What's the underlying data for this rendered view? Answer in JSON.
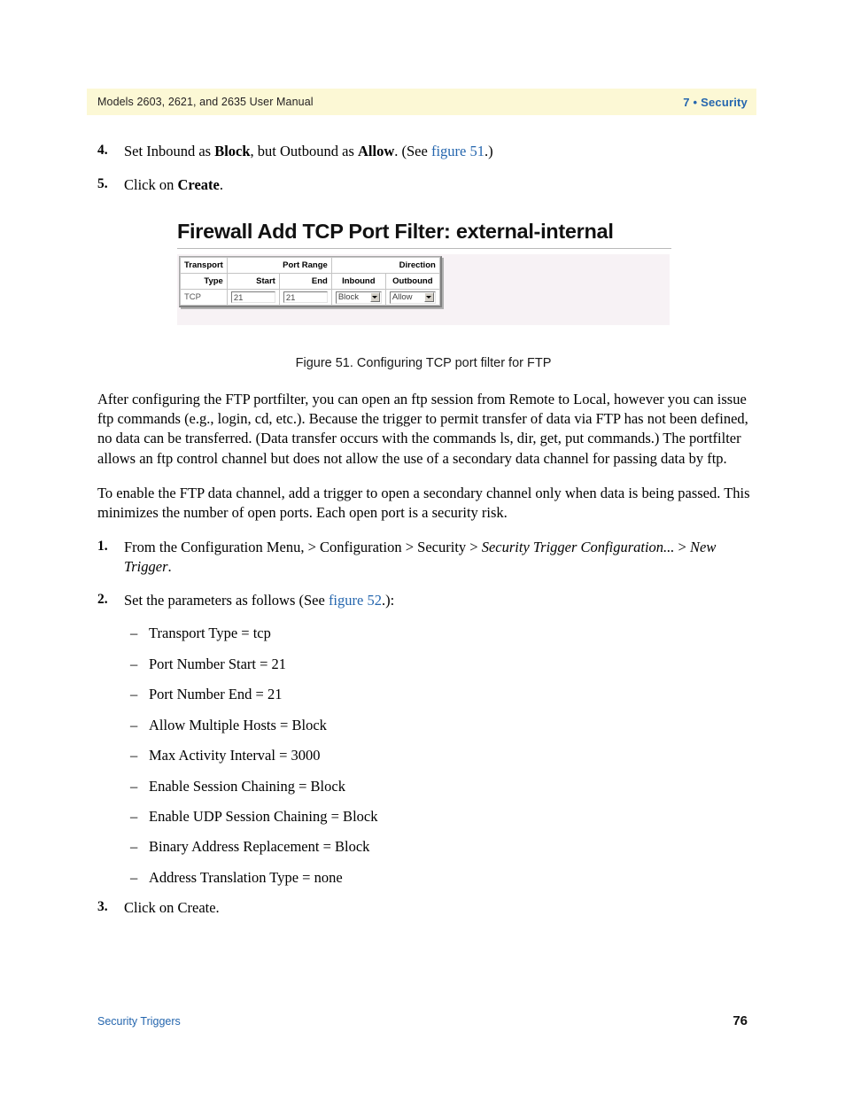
{
  "header": {
    "left": "Models 2603, 2621, and 2635 User Manual",
    "right": "7 • Security",
    "band_color": "#fcf8d5",
    "accent_color": "#2566ae"
  },
  "top_steps": [
    {
      "num": "4.",
      "parts": [
        {
          "text": "Set Inbound as ",
          "style": "normal"
        },
        {
          "text": "Block",
          "style": "bold"
        },
        {
          "text": ", but Outbound as ",
          "style": "normal"
        },
        {
          "text": "Allow",
          "style": "bold"
        },
        {
          "text": ". (See ",
          "style": "normal"
        },
        {
          "text": "figure 51",
          "style": "link"
        },
        {
          "text": ".)",
          "style": "normal"
        }
      ]
    },
    {
      "num": "5.",
      "parts": [
        {
          "text": "Click on ",
          "style": "normal"
        },
        {
          "text": "Create",
          "style": "bold"
        },
        {
          "text": ".",
          "style": "normal"
        }
      ]
    }
  ],
  "figure": {
    "title": "Firewall Add TCP Port Filter: external-internal",
    "caption": "Figure 51. Configuring TCP port filter for FTP",
    "panel_bg": "#f7f2f5",
    "table": {
      "group_headers": [
        {
          "label": "Transport",
          "align": "left"
        },
        {
          "label": "Port Range",
          "align": "right"
        },
        {
          "label": "Direction",
          "align": "right"
        }
      ],
      "column_headers": [
        "Type",
        "Start",
        "End",
        "Inbound",
        "Outbound"
      ],
      "row": {
        "type": "TCP",
        "start": "21",
        "end": "21",
        "inbound": "Block",
        "outbound": "Allow"
      }
    }
  },
  "paragraphs": [
    "After configuring the FTP portfilter, you can open an ftp session from Remote to Local, however you can issue ftp commands (e.g., login, cd, etc.). Because the trigger to permit transfer of data via FTP has not been defined, no data can be transferred. (Data transfer occurs with the commands ls, dir, get, put commands.) The portfilter allows an ftp control channel but does not allow the use of a secondary data channel for passing data by ftp.",
    "To enable the FTP data channel, add a trigger to open a secondary channel only when data is being passed. This minimizes the number of open ports. Each open port is a security risk."
  ],
  "bottom_steps": {
    "step1": {
      "num": "1.",
      "parts": [
        {
          "text": "From the Configuration Menu, > Configuration > Security > ",
          "style": "normal"
        },
        {
          "text": "Security Trigger Configuration...",
          "style": "italic"
        },
        {
          "text": " > ",
          "style": "normal"
        },
        {
          "text": "New Trigger",
          "style": "italic"
        },
        {
          "text": ".",
          "style": "normal"
        }
      ]
    },
    "step2": {
      "num": "2.",
      "parts": [
        {
          "text": "Set the parameters as follows (See ",
          "style": "normal"
        },
        {
          "text": "figure 52",
          "style": "link"
        },
        {
          "text": ".):",
          "style": "normal"
        }
      ]
    },
    "step3": {
      "num": "3.",
      "parts": [
        {
          "text": "Click on Create.",
          "style": "normal"
        }
      ]
    }
  },
  "parameters": [
    {
      "dash": "–",
      "text": "Transport Type = tcp"
    },
    {
      "dash": "–",
      "text": "Port Number Start = 21"
    },
    {
      "dash": "–",
      "text": "Port Number End = 21"
    },
    {
      "dash": "–",
      "text": "Allow Multiple Hosts = Block"
    },
    {
      "dash": "–",
      "text": "Max Activity Interval = 3000"
    },
    {
      "dash": "–",
      "text": "Enable Session Chaining = Block"
    },
    {
      "dash": "–",
      "text": "Enable UDP Session Chaining = Block"
    },
    {
      "dash": "–",
      "text": "Binary Address Replacement = Block"
    },
    {
      "dash": "–",
      "text": "Address Translation Type = none"
    }
  ],
  "footer": {
    "left": "Security Triggers",
    "right": "76"
  }
}
